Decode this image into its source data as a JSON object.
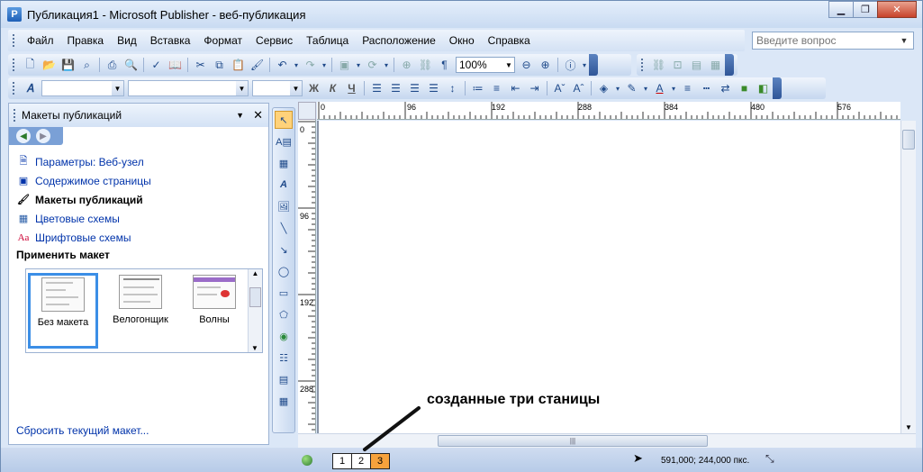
{
  "window": {
    "title": "Публикация1 - Microsoft Publisher - веб-публикация",
    "icon_label": "P",
    "controls": [
      "minimize-icon",
      "maximize-icon",
      "close-icon"
    ]
  },
  "menu": {
    "items": [
      "Файл",
      "Правка",
      "Вид",
      "Вставка",
      "Формат",
      "Сервис",
      "Таблица",
      "Расположение",
      "Окно",
      "Справка"
    ]
  },
  "help_box": {
    "placeholder": "Введите вопрос"
  },
  "standard_toolbar": {
    "zoom": "100%",
    "paragraph_mark": "¶"
  },
  "format_toolbar": {
    "bold": "Ж",
    "italic": "К",
    "underline": "Ч"
  },
  "task_pane": {
    "title": "Макеты публикаций",
    "links": [
      {
        "label": "Параметры: Веб-узел",
        "icon": "page-settings-icon"
      },
      {
        "label": "Содержимое страницы",
        "icon": "page-content-icon"
      },
      {
        "label": "Макеты публикаций",
        "icon": "publication-designs-icon"
      },
      {
        "label": "Цветовые схемы",
        "icon": "color-schemes-icon"
      },
      {
        "label": "Шрифтовые схемы",
        "icon": "font-schemes-icon"
      }
    ],
    "apply_title": "Применить макет",
    "designs": [
      "Без макета",
      "Велогонщик",
      "Волны"
    ],
    "selected_design": "Без макета",
    "reset_link": "Сбросить текущий макет..."
  },
  "rulers": {
    "horizontal": [
      "0",
      "96",
      "192",
      "288",
      "384",
      "480",
      "576"
    ],
    "vertical": [
      "0",
      "96",
      "192",
      "288"
    ]
  },
  "status": {
    "pages": [
      "1",
      "2",
      "3"
    ],
    "active_page": "3",
    "coords": "591,000; 244,000 пкс."
  },
  "annotation": "созданные три станицы"
}
